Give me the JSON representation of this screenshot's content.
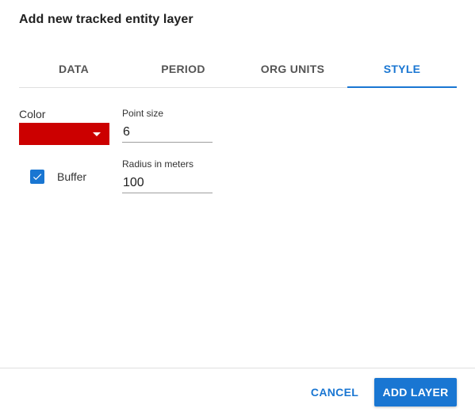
{
  "dialog": {
    "title": "Add new tracked entity layer"
  },
  "tabs": [
    {
      "label": "DATA",
      "active": false
    },
    {
      "label": "PERIOD",
      "active": false
    },
    {
      "label": "ORG UNITS",
      "active": false
    },
    {
      "label": "STYLE",
      "active": true
    }
  ],
  "style": {
    "color_label": "Color",
    "color_value": "#cc0000",
    "buffer_label": "Buffer",
    "buffer_checked": true,
    "point_size_label": "Point size",
    "point_size_value": "6",
    "radius_label": "Radius in meters",
    "radius_value": "100"
  },
  "actions": {
    "cancel_label": "CANCEL",
    "add_label": "ADD LAYER"
  },
  "colors": {
    "accent": "#1976d2",
    "swatch": "#cc0000"
  }
}
